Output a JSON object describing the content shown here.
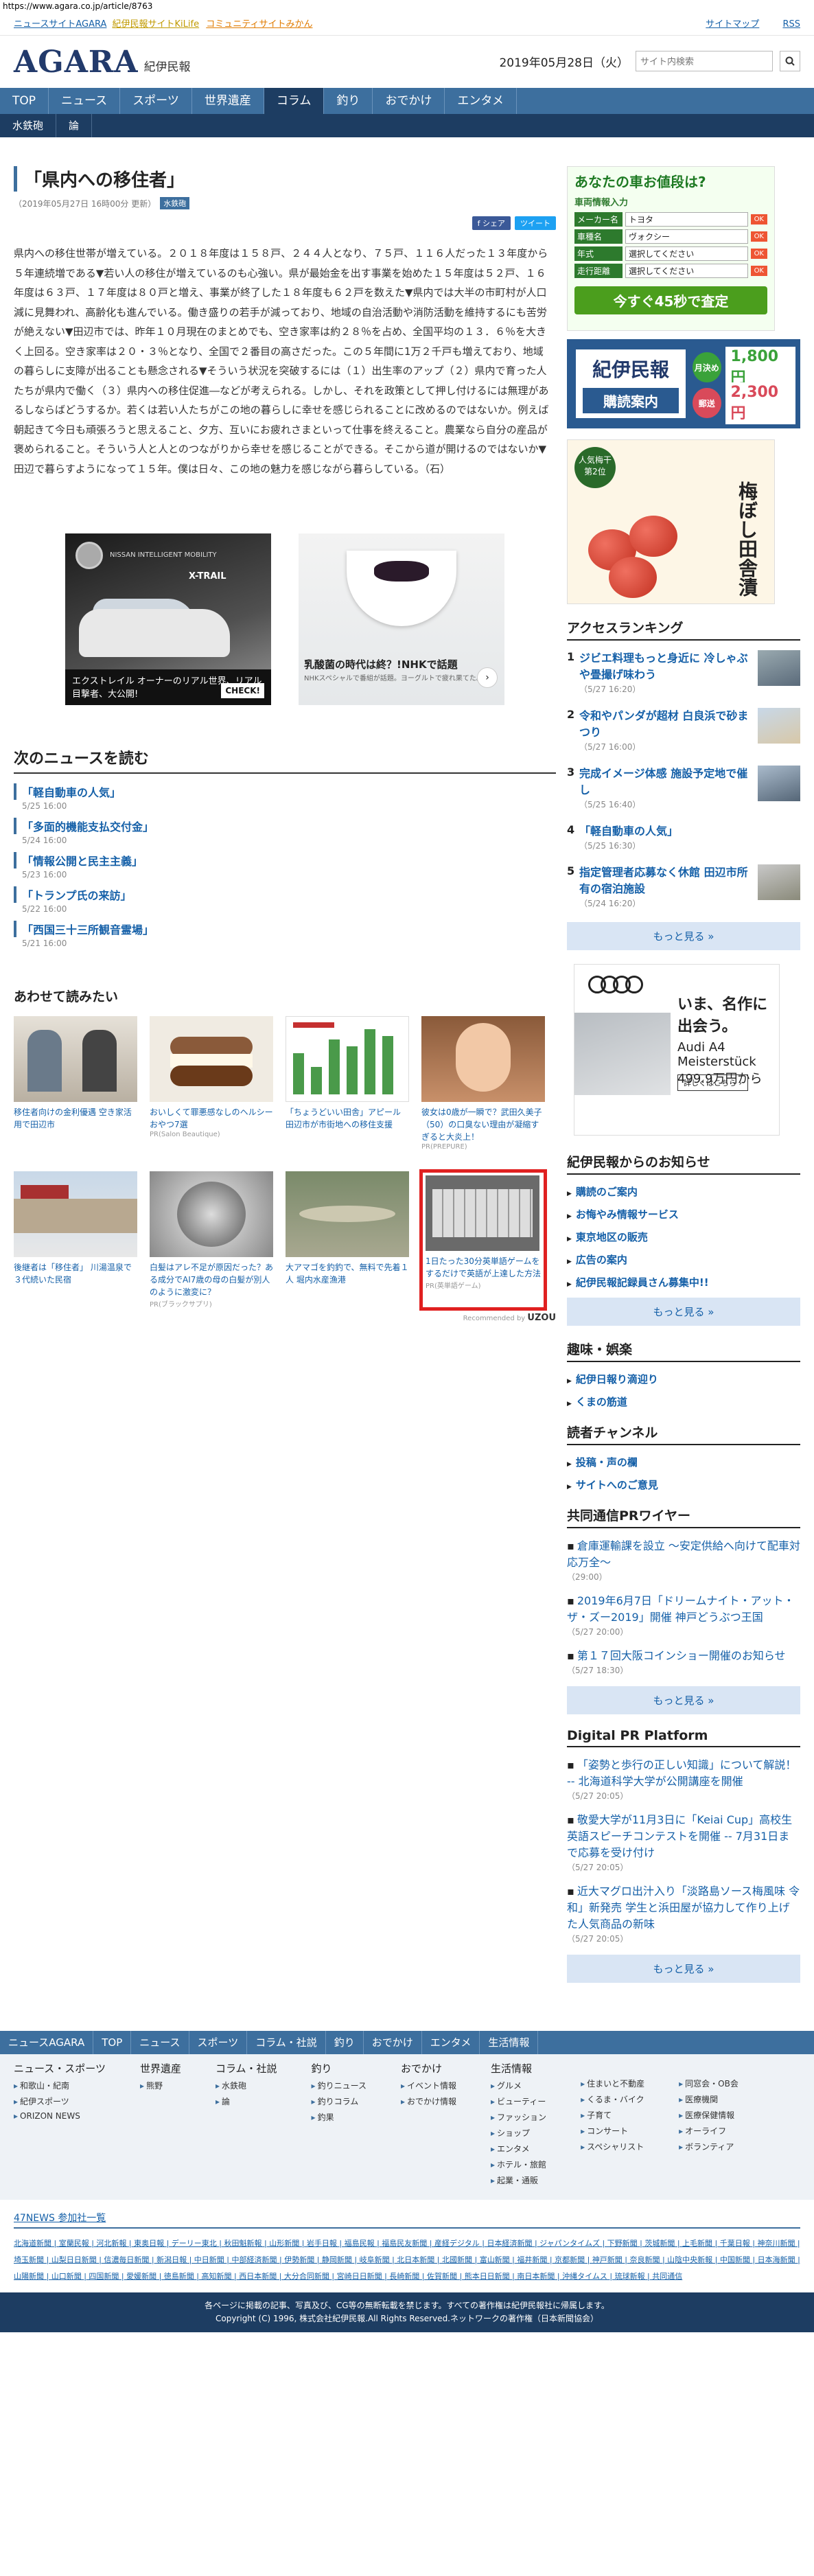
{
  "url": "https://www.agara.co.jp/article/8763",
  "toplinks": {
    "left_label": "ニュースサイトAGARA",
    "link_kilife": "紀伊民報サイトKiLife",
    "link_mikan": "コミュニティサイトみかん",
    "right_sitemap": "サイトマップ",
    "right_rss": "RSS"
  },
  "header": {
    "logo": "AGARA",
    "logo_sub": "紀伊民報",
    "date": "2019年05月28日（火）",
    "search_placeholder": "サイト内検索"
  },
  "mainnav": [
    "TOP",
    "ニュース",
    "スポーツ",
    "世界遺産",
    "コラム",
    "釣り",
    "おでかけ",
    "エンタメ"
  ],
  "subnav": [
    "水鉄砲",
    "論"
  ],
  "article": {
    "title": "「県内への移住者」",
    "date": "（2019年05月27日 16時00分 更新）",
    "tag": "水鉄砲",
    "share_fb": "f シェア",
    "share_tw": "ツイート",
    "body": "県内への移住世帯が増えている。２０１８年度は１５８戸、２４４人となり、７５戸、１１６人だった１３年度から５年連続増である▼若い人の移住が増えているのも心強い。県が最始金を出す事業を始めた１５年度は５２戸、１６年度は６３戸、１７年度は８０戸と増え、事業が終了した１８年度も６２戸を数えた▼県内では大半の市町村が人口減に見舞われ、高齢化も進んでいる。働き盛りの若手が減っており、地域の自治活動や消防活動を維持するにも苦労が絶えない▼田辺市では、昨年１０月現在のまとめでも、空き家率は約２８％を占め、全国平均の１３．６％を大きく上回る。空き家率は２０・３％となり、全国で２番目の高さだった。この５年間に1万２千戸も増えており、地域の暮らしに支障が出ることも懸念される▼そういう状況を突破するには（１）出生率のアップ（２）県内で育った人たちが県内で働く（３）県内への移住促進―などが考えられる。しかし、それを政策として押し付けるには無理があるしならばどうするか。若くは若い人たちがこの地の暮らしに幸せを感じられることに改めるのではないか。例えば朝起きて今日も頑張ろうと思えること、夕方、互いにお疲れさまといって仕事を終えること。農業なら自分の産品が褒められること。そういう人と人とのつながりから幸せを感じることができる。そこから道が開けるのではないか▼田辺で暮らすようになって１５年。僕は日々、この地の魅力を感じながら暮らしている。（石）"
  },
  "ads_main": {
    "nissan_brand": "NISSAN INTELLIGENT MOBILITY",
    "nissan_model": "X-TRAIL",
    "nissan_text": "エクストレイル オーナーのリアル世界、リアル目撃者、大公開!",
    "nissan_cta": "CHECK!",
    "nhk_title": "乳酸菌の時代は終？!NHKで話題",
    "nhk_sub": "NHKスペシャルで番組が話題。ヨーグルトで疲れ果てた。"
  },
  "next_news": {
    "heading": "次のニュースを読む",
    "items": [
      {
        "title": "「軽自動車の人気」",
        "date": "5/25 16:00"
      },
      {
        "title": "「多面的機能支払交付金」",
        "date": "5/24 16:00"
      },
      {
        "title": "「情報公開と民主主義」",
        "date": "5/23 16:00"
      },
      {
        "title": "「トランプ氏の来訪」",
        "date": "5/22 16:00"
      },
      {
        "title": "「西国三十三所観音霊場」",
        "date": "5/21 16:00"
      }
    ]
  },
  "related": {
    "heading": "あわせて読みたい",
    "items": [
      {
        "title": "移住者向けの金利優遇 空き家活用で田辺市",
        "pr": ""
      },
      {
        "title": "おいしくて罪悪感なしのヘルシーおやつ7選",
        "pr": "PR(Salon Beautique)"
      },
      {
        "title": "「ちょうどいい田舎」アピール 田辺市が市街地への移住支援",
        "pr": ""
      },
      {
        "title": "彼女は0歳が一瞬で？武田久美子（50）の口臭ない理由が凝縮すぎると大炎上！",
        "pr": "PR(PREPURE)"
      },
      {
        "title": "後継者は「移住者」 川湯温泉で３代続いた民宿",
        "pr": ""
      },
      {
        "title": "白髪はアレ不足が原因だった？ある成分でAI7歳の母の白髪が別人のように激変に？",
        "pr": "PR(ブラックサプリ)"
      },
      {
        "title": "大アマゴを釣釣で、無料で先着１人 堀内水産漁港",
        "pr": ""
      },
      {
        "title": "1日たった30分英単語ゲームをするだけで英語が上達した方法",
        "pr": "PR(英単語ゲーム)"
      }
    ],
    "recommended_by": "Recommended by",
    "recommended_brand": "UZOU"
  },
  "side": {
    "car_ad": {
      "title": "あなたの車お値段は?",
      "sub": "車両情報入力",
      "rows": [
        {
          "k": "メーカー名",
          "v": "トヨタ"
        },
        {
          "k": "車種名",
          "v": "ヴォクシー"
        },
        {
          "k": "年式",
          "v": "選択してください"
        },
        {
          "k": "走行距離",
          "v": "選択してください"
        }
      ],
      "ok": "OK",
      "btn": "今すぐ45秒で査定"
    },
    "subscription": {
      "name": "紀伊民報",
      "label": "購読案内",
      "p1_tag": "月決め",
      "p1": "1,800円",
      "p2_tag": "郵送",
      "p2": "2,300円"
    },
    "ume_ad": {
      "badge": "人気梅干 第2位",
      "title": "梅ぼし田舎漬"
    },
    "ranking": {
      "heading": "アクセスランキング",
      "items": [
        {
          "n": "1",
          "t": "ジビエ料理もっと身近に 冷しゃぶや畳撮げ味わう",
          "d": "（5/27 16:20）"
        },
        {
          "n": "2",
          "t": "令和やパンダが超材 白良浜で砂まつり",
          "d": "（5/27 16:00）"
        },
        {
          "n": "3",
          "t": "完成イメージ体感 施設予定地で催し",
          "d": "（5/25 16:40）"
        },
        {
          "n": "4",
          "t": "「軽自動車の人気」",
          "d": "（5/25 16:30）"
        },
        {
          "n": "5",
          "t": "指定管理者応募なく休館 田辺市所有の宿泊施設",
          "d": "（5/24 16:20）"
        }
      ],
      "more": "もっと見る »"
    },
    "audi": {
      "t1": "いま、名作に出会う。",
      "t2": "Audi A4 Meisterstück 499.9万円から",
      "cta": "詳しくはこちら ›"
    },
    "notice": {
      "heading": "紀伊民報からのお知らせ",
      "items": [
        "購読のご案内",
        "お悔やみ情報サービス",
        "東京地区の販売",
        "広告の案内",
        "紀伊民報記録員さん募集中!!"
      ],
      "more": "もっと見る »"
    },
    "hobby": {
      "heading": "趣味・娯楽",
      "items": [
        "紀伊日報り滴迎り",
        "くまの筋道"
      ]
    },
    "reader": {
      "heading": "読者チャンネル",
      "items": [
        "投稿・声の欄",
        "サイトへのご意見"
      ]
    },
    "prwire": {
      "heading": "共同通信PRワイヤー",
      "items": [
        {
          "t": "倉庫運輸課を設立 ～安定供給へ向けて配車対応万全～",
          "d": "（29:00）"
        },
        {
          "t": "2019年6月7日「ドリームナイト・アット・ザ・ズー2019」開催 神戸どうぶつ王国",
          "d": "（5/27 20:00）"
        },
        {
          "t": "第１７回大阪コインショー開催のお知らせ",
          "d": "（5/27 18:30）"
        }
      ],
      "more": "もっと見る »"
    },
    "digitalpr": {
      "heading": "Digital PR Platform",
      "items": [
        {
          "t": "「姿勢と歩行の正しい知識」について解説！ -- 北海道科学大学が公開講座を開催",
          "d": "（5/27 20:05）"
        },
        {
          "t": "敬愛大学が11月3日に「Keiai Cup」高校生英語スピーチコンテストを開催 -- 7月31日まで応募を受け付け",
          "d": "（5/27 20:05）"
        },
        {
          "t": "近大マグロ出汁入り「淡路島ソース梅風味 令和」新発売 学生と浜田屋が協力して作り上げた人気商品の新味",
          "d": "（5/27 20:05）"
        }
      ],
      "more": "もっと見る »"
    }
  },
  "footer": {
    "nav": [
      "ニュースAGARA",
      "TOP",
      "ニュース",
      "スポーツ",
      "コラム・社説",
      "釣り",
      "おでかけ",
      "エンタメ",
      "生活情報"
    ],
    "cols": [
      {
        "h": "ニュース・スポーツ",
        "items": [
          "和歌山・紀南",
          "紀伊スポーツ",
          "ORIZON NEWS"
        ]
      },
      {
        "h": "世界遺産",
        "items": [
          "熊野"
        ]
      },
      {
        "h": "コラム・社説",
        "items": [
          "水鉄砲",
          "論"
        ]
      },
      {
        "h": "釣り",
        "items": [
          "釣りニュース",
          "釣りコラム",
          "釣果"
        ]
      },
      {
        "h": "おでかけ",
        "items": [
          "イベント情報",
          "おでかけ情報"
        ]
      },
      {
        "h": "生活情報",
        "items": [
          "グルメ",
          "ビューティー",
          "ファッション",
          "ショップ",
          "エンタメ",
          "ホテル・旅館",
          "起業・通販"
        ]
      },
      {
        "h": "",
        "items": [
          "住まいと不動産",
          "くるま・バイク",
          "子育て",
          "コンサート",
          "スペシャリスト"
        ]
      },
      {
        "h": "",
        "items": [
          "同窓会・OB会",
          "医療機関",
          "医療保健情報",
          "オーライフ",
          "ボランティア"
        ]
      }
    ],
    "news47_heading": "47NEWS 参加社一覧",
    "news47_members": "北海道新聞 | 室蘭民報 | 河北新報 | 東奥日報 | デーリー東北 | 秋田魁新報 | 山形新聞 | 岩手日報 | 福島民報 | 福島民友新聞 | 産経デジタル | 日本経済新聞 | ジャパンタイムズ | 下野新聞 | 茨城新聞 | 上毛新聞 | 千葉日報 | 神奈川新聞 | 埼玉新聞 | 山梨日日新聞 | 信濃毎日新聞 | 新潟日報 | 中日新聞 | 中部経済新聞 | 伊勢新聞 | 静岡新聞 | 岐阜新聞 | 北日本新聞 | 北國新聞 | 富山新聞 | 福井新聞 | 京都新聞 | 神戸新聞 | 奈良新聞 | 山陰中央新報 | 中国新聞 | 日本海新聞 | 山陽新聞 | 山口新聞 | 四国新聞 | 愛媛新聞 | 徳島新聞 | 高知新聞 | 西日本新聞 | 大分合同新聞 | 宮崎日日新聞 | 長崎新聞 | 佐賀新聞 | 熊本日日新聞 | 南日本新聞 | 沖縄タイムス | 琉球新報 | 共同通信",
    "copy1": "各ページに掲載の記事、写真及び、CG等の無断転載を禁じます。すべての著作権は紀伊民報社に帰属します。",
    "copy2": "Copyright (C) 1996, 株式会社紀伊民報.All Rights Reserved.ネットワークの著作権（日本新聞協会）"
  }
}
